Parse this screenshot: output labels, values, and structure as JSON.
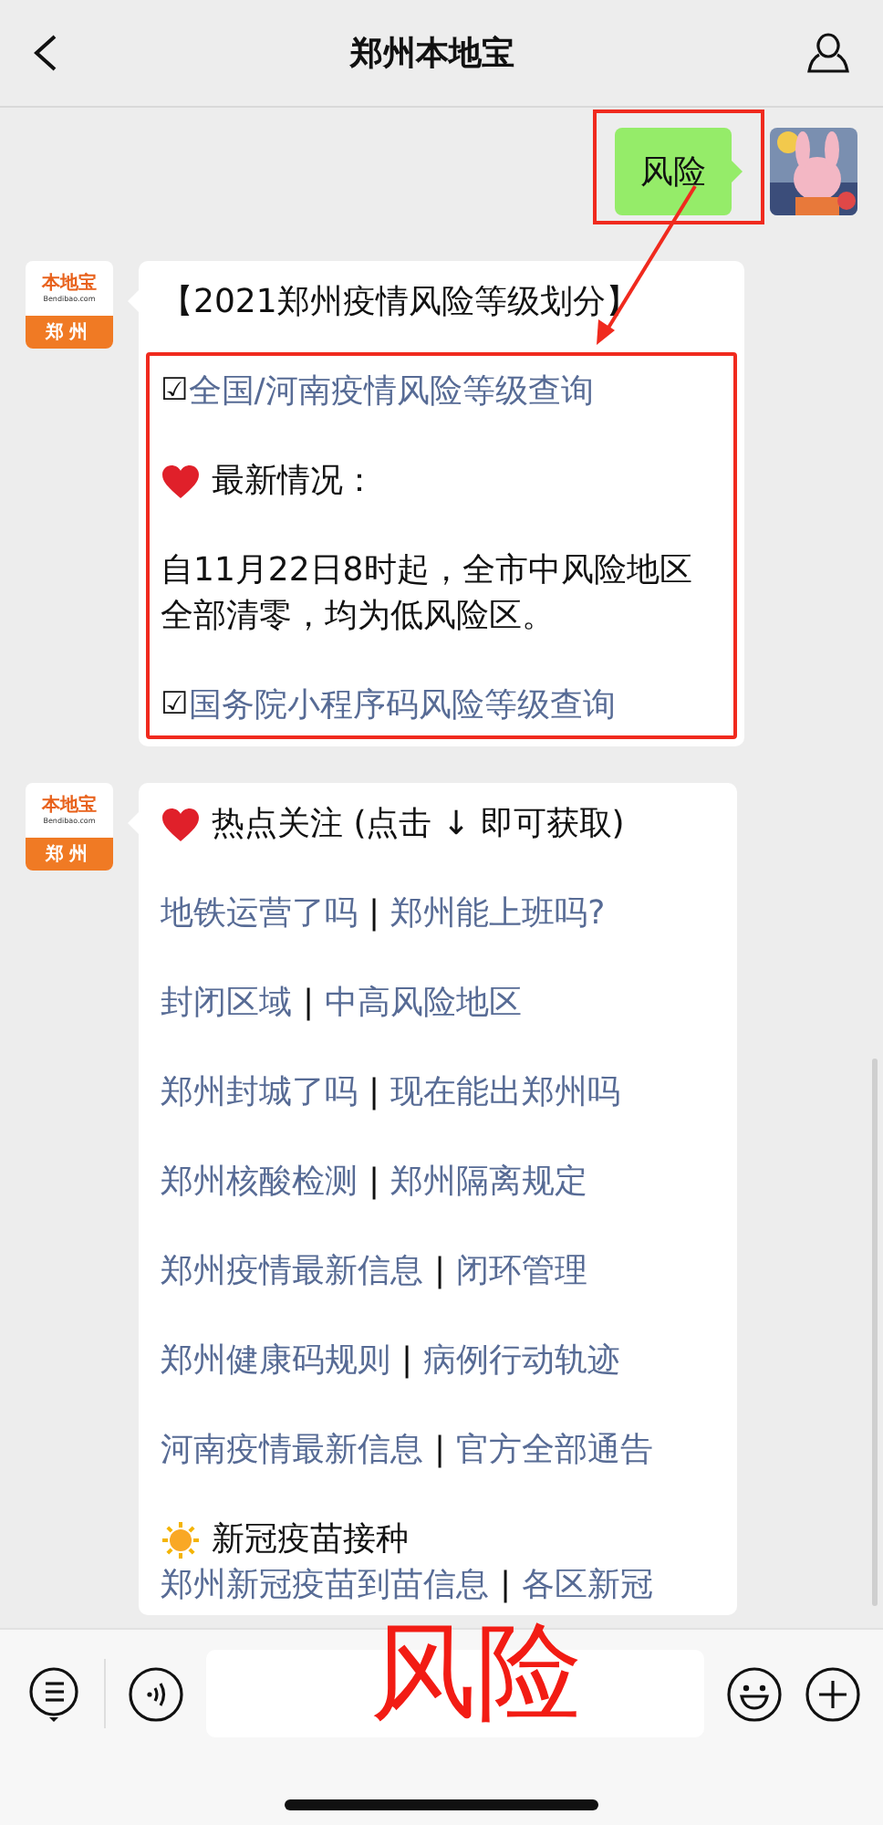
{
  "header": {
    "title": "郑州本地宝"
  },
  "messages": [
    {
      "kind": "sent",
      "text": "风险",
      "highlighted": true
    },
    {
      "kind": "card",
      "avatar": {
        "logo": "本地宝",
        "domain": "Bendibao.com",
        "city": "郑州"
      },
      "blocks": [
        {
          "kind": "title",
          "text": "【2021郑州疫情风险等级划分】"
        },
        {
          "kind": "group",
          "highlighted": true,
          "blocks": [
            {
              "kind": "check_link",
              "mark": "☑",
              "text": "全国/河南疫情风险等级查询"
            },
            {
              "kind": "heart_heading",
              "text": "最新情况："
            },
            {
              "kind": "text",
              "text": "自11月22日8时起，全市中风险地区全部清零，均为低风险区。"
            },
            {
              "kind": "check_link",
              "mark": "☑",
              "text": "国务院小程序码风险等级查询"
            }
          ]
        }
      ]
    },
    {
      "kind": "card",
      "avatar": {
        "logo": "本地宝",
        "domain": "Bendibao.com",
        "city": "郑州"
      },
      "blocks": [
        {
          "kind": "heart_heading",
          "text": "热点关注 (点击 ↓ 即可获取)"
        },
        {
          "kind": "link_pair",
          "links": [
            "地铁运营了吗",
            "郑州能上班吗?"
          ],
          "separator": "|"
        },
        {
          "kind": "link_pair",
          "links": [
            "封闭区域",
            "中高风险地区"
          ],
          "separator": "|"
        },
        {
          "kind": "link_pair",
          "links": [
            "郑州封城了吗",
            "现在能出郑州吗"
          ],
          "separator": "|"
        },
        {
          "kind": "link_pair",
          "links": [
            "郑州核酸检测",
            "郑州隔离规定"
          ],
          "separator": "|"
        },
        {
          "kind": "link_pair",
          "links": [
            "郑州疫情最新信息",
            "闭环管理"
          ],
          "separator": "|"
        },
        {
          "kind": "link_pair",
          "links": [
            "郑州健康码规则",
            "病例行动轨迹"
          ],
          "separator": "|"
        },
        {
          "kind": "link_pair",
          "links": [
            "河南疫情最新信息",
            "官方全部通告"
          ],
          "separator": "|"
        },
        {
          "kind": "sun_heading",
          "text": "新冠疫苗接种"
        },
        {
          "kind": "link_pair",
          "links": [
            "郑州新冠疫苗到苗信息",
            "各区新冠"
          ],
          "separator": "|"
        }
      ]
    }
  ],
  "input_bar": {
    "annotation": "风险"
  }
}
